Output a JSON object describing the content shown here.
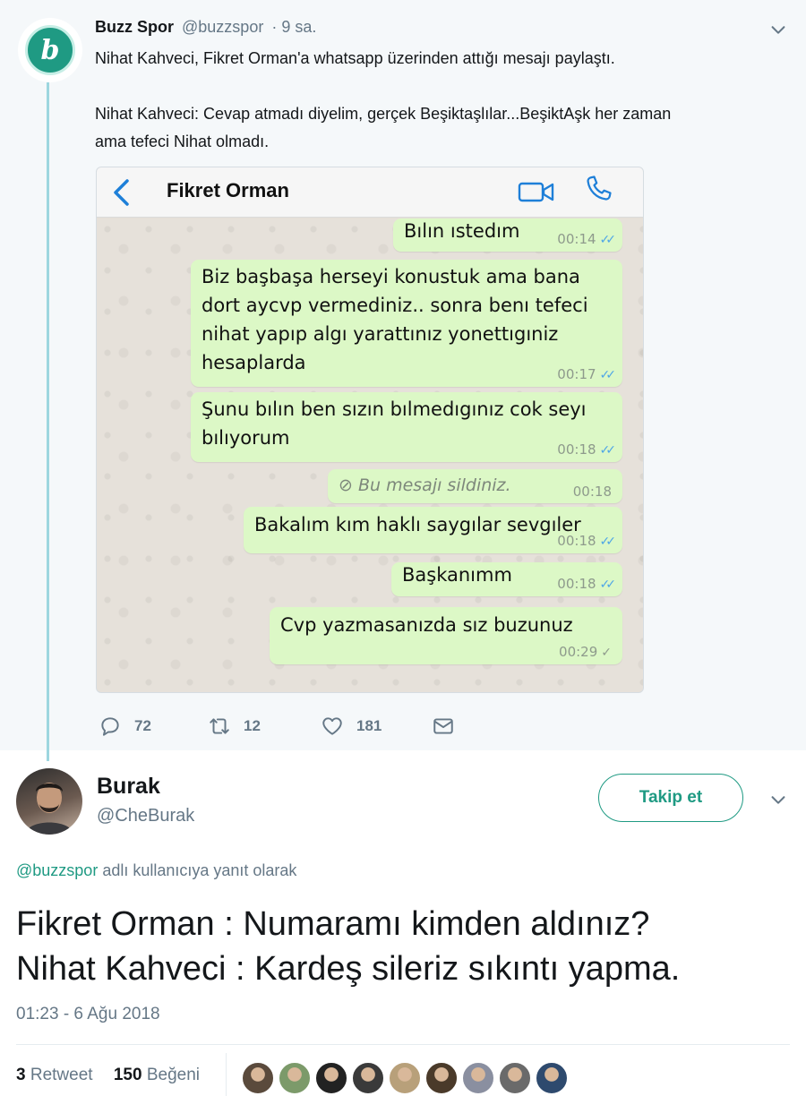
{
  "parent_tweet": {
    "author_name": "Buzz Spor",
    "author_handle": "@buzzspor",
    "time_ago": "· 9 sa.",
    "avatar_letter": "b",
    "text_line_1": "Nihat Kahveci, Fikret Orman'a whatsapp üzerinden attığı mesajı paylaştı.",
    "text_line_2": "Nihat Kahveci: Cevap atmadı diyelim, gerçek Beşiktaşlılar...BeşiktAşk her zaman",
    "text_line_3": "ama tefeci Nihat olmadı.",
    "actions": {
      "replies": "72",
      "retweets": "12",
      "likes": "181"
    }
  },
  "whatsapp": {
    "contact_name": "Fikret Orman",
    "messages": [
      {
        "text": "Bılın ıstedım",
        "time": "00:14",
        "status": "read"
      },
      {
        "lines": [
          "Biz başbaşa herseyi konustuk ama bana",
          "dort aycvp vermediniz.. sonra benı tefeci",
          "nihat yapıp algı yarattınız yonettıgıniz",
          "hesaplarda"
        ],
        "time": "00:17",
        "status": "read"
      },
      {
        "lines": [
          "Şunu bılın ben sızın bılmedıgınız cok seyı",
          "bılıyorum"
        ],
        "time": "00:18",
        "status": "read"
      },
      {
        "text": "Bu mesajı sildiniz.",
        "time": "00:18",
        "status": "deleted"
      },
      {
        "text": "Bakalım kım haklı saygılar sevgıler",
        "time": "00:18",
        "status": "read"
      },
      {
        "text": "Başkanımm",
        "time": "00:18",
        "status": "read"
      },
      {
        "text": "Cvp yazmasanızda sız buzunuz",
        "time": "00:29",
        "status": "sent"
      }
    ]
  },
  "reply_tweet": {
    "author_name": "Burak",
    "author_handle": "@CheBurak",
    "follow_label": "Takip et",
    "reply_to_mention": "@buzzspor",
    "reply_to_suffix": " adlı kullanıcıya yanıt olarak",
    "text_line_1": "Fikret Orman : Numaramı kimden aldınız?",
    "text_line_2": "Nihat Kahveci : Kardeş sileriz sıkıntı yapma.",
    "timestamp": "01:23 - 6 Ağu 2018",
    "retweet_count": "3",
    "retweet_label": "Retweet",
    "like_count": "150",
    "like_label": "Beğeni",
    "liker_colors": [
      "#5a4a3c",
      "#7c9a6a",
      "#222222",
      "#3a3a3a",
      "#b8a07a",
      "#4a3a2a",
      "#8a8fa0",
      "#6a6a6a",
      "#2e4a6e"
    ]
  },
  "colors": {
    "accent": "#1f9a83",
    "bubble": "#dcf8c6",
    "read_ticks": "#4fa6e6"
  }
}
